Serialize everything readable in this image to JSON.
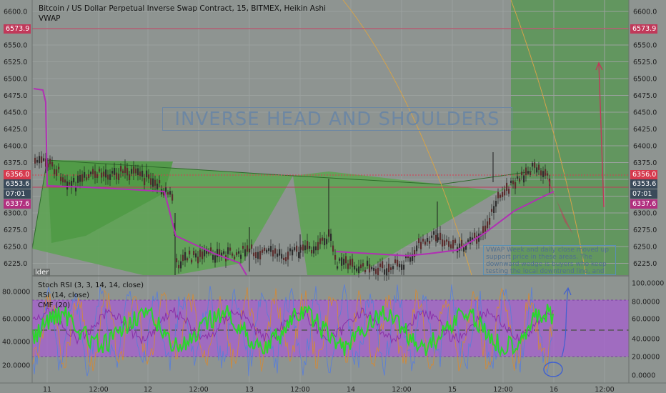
{
  "header": {
    "title": "Bitcoin / US Dollar Perpetual Inverse Swap Contract, 15, BITMEX, Heikin Ashi",
    "vwap_label": "VWAP"
  },
  "price_axis": {
    "ticks": [
      "6600.0",
      "6575.0",
      "6550.0",
      "6525.0",
      "6500.0",
      "6475.0",
      "6450.0",
      "6425.0",
      "6400.0",
      "6375.0",
      "6350.0",
      "6325.0",
      "6300.0",
      "6275.0",
      "6250.0",
      "6225.0"
    ],
    "tags": [
      {
        "text": "6573.9",
        "color": "#c0395a"
      },
      {
        "text": "6356.0",
        "color": "#d63a4e"
      },
      {
        "text": "6353.6",
        "color": "#3a4a5a"
      },
      {
        "text": "07:01",
        "color": "#3a4a5a"
      },
      {
        "text": "6337.6",
        "color": "#b12f7f"
      }
    ]
  },
  "osc_axis": {
    "left_ticks": [
      "80.0000",
      "60.0000",
      "40.0000",
      "20.0000"
    ],
    "right_ticks": [
      "100.0000",
      "80.0000",
      "60.0000",
      "40.0000",
      "20.0000",
      "0.0000"
    ]
  },
  "time_axis": {
    "labels": [
      "11",
      "12:00",
      "12",
      "12:00",
      "13",
      "12:00",
      "14",
      "12:00",
      "15",
      "12:00",
      "16",
      "12:00"
    ]
  },
  "oscillators": {
    "stoch": "Stoch RSI (3, 3, 14, 14, close)",
    "rsi": "RSI (14, close)",
    "cmf": "CMF (20)"
  },
  "annotations": {
    "pattern": "INVERSE HEAD AND SHOULDERS",
    "note": "VWAP Week and daily close moved up support price in these areas. The downward wedge is buyers who keep testing the local downtrend line, and sellers will eventually tire out with the",
    "side": "lder"
  },
  "colors": {
    "bg": "#8e9491",
    "green_fill": "#5ea354",
    "vwap": "#b12fb4",
    "red_line": "#c0395a",
    "rsi_band": "#a55fd0",
    "stoch": "#2bd62b"
  }
}
